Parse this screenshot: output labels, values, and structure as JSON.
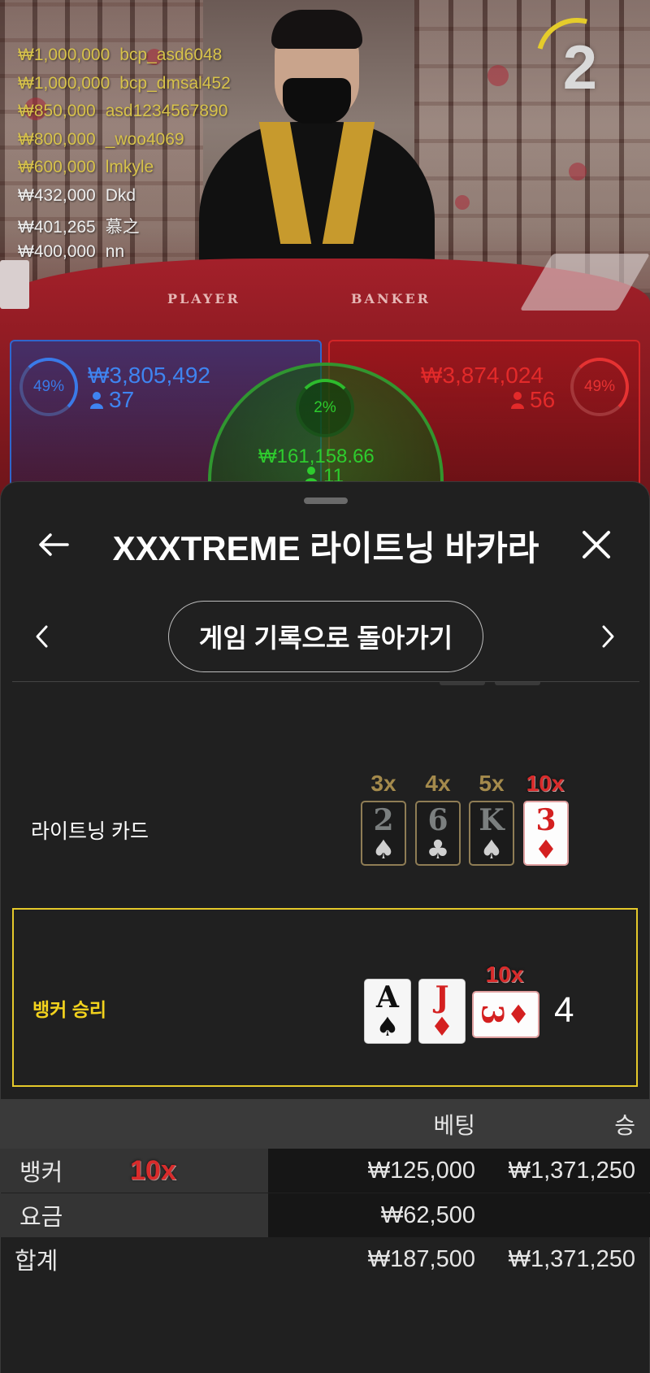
{
  "video": {
    "round_number": "2",
    "table_labels": {
      "player": "PLAYER",
      "banker": "BANKER"
    },
    "winners": [
      {
        "amount": "₩1,000,000",
        "name": "bcp_asd6048",
        "color": "yellow"
      },
      {
        "amount": "₩1,000,000",
        "name": "bcp_dmsal452",
        "color": "yellow"
      },
      {
        "amount": "₩850,000",
        "name": "asd1234567890",
        "color": "yellow"
      },
      {
        "amount": "₩800,000",
        "name": "_woo4069",
        "color": "yellow"
      },
      {
        "amount": "₩600,000",
        "name": "lmkyle",
        "color": "yellow"
      },
      {
        "amount": "₩432,000",
        "name": "Dkd",
        "color": "white"
      },
      {
        "amount": "₩401,265",
        "name": "慕之",
        "color": "white"
      },
      {
        "amount": "₩400,000",
        "name": "nn",
        "color": "white"
      }
    ],
    "stats": {
      "player": {
        "percent": "49%",
        "amount": "₩3,805,492",
        "players": "37",
        "color": "#3f84f0"
      },
      "tie": {
        "percent": "2%",
        "amount": "₩161,158.66",
        "players": "11",
        "color": "#2ecc2e"
      },
      "banker": {
        "percent": "49%",
        "amount": "₩3,874,024",
        "players": "56",
        "color": "#e32a2a"
      }
    }
  },
  "sheet": {
    "back_icon": "arrow-left-icon",
    "title": "XXXTREME 라이트닝 바카라",
    "close_icon": "close-icon",
    "prev_icon": "chevron-left-icon",
    "next_icon": "chevron-right-icon",
    "history_button": "게임 기록으로 돌아가기",
    "lightning": {
      "label": "라이트닝 카드",
      "cards": [
        {
          "multiplier": "3x",
          "rank": "2",
          "suit": "♠",
          "style": "dark"
        },
        {
          "multiplier": "4x",
          "rank": "6",
          "suit": "♣",
          "style": "dark"
        },
        {
          "multiplier": "5x",
          "rank": "K",
          "suit": "♠",
          "style": "dark"
        },
        {
          "multiplier": "10x",
          "rank": "3",
          "suit": "♦",
          "style": "highlight"
        }
      ]
    },
    "result": {
      "label": "뱅커 승리",
      "cards": [
        {
          "rank": "A",
          "suit": "♠",
          "color": "black"
        },
        {
          "rank": "J",
          "suit": "♦",
          "color": "red"
        }
      ],
      "third_card": {
        "multiplier": "10x",
        "rank": "3",
        "suit": "♦"
      },
      "score": "4"
    },
    "summary": {
      "headers": {
        "bet": "베팅",
        "win": "승"
      },
      "rows": [
        {
          "label": "뱅커",
          "multiplier": "10x",
          "bet": "₩125,000",
          "win": "₩1,371,250"
        },
        {
          "label": "요금",
          "multiplier": "",
          "bet": "₩62,500",
          "win": ""
        }
      ],
      "total": {
        "label": "합계",
        "bet": "₩187,500",
        "win": "₩1,371,250"
      }
    }
  }
}
